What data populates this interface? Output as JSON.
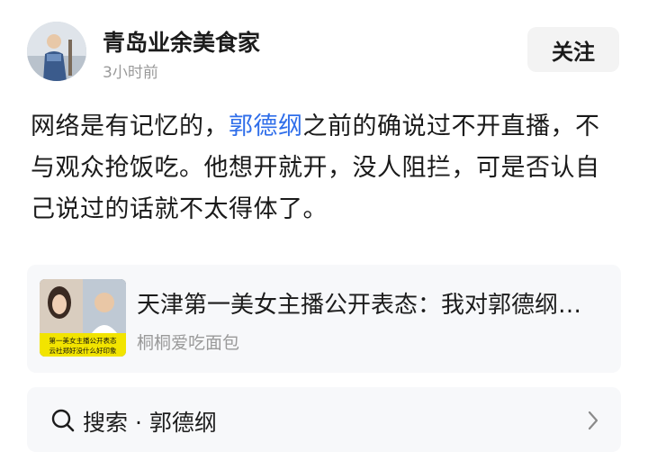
{
  "author": {
    "name": "青岛业余美食家",
    "time": "3小时前",
    "follow_label": "关注"
  },
  "post": {
    "text_before": "网络是有记忆的，",
    "topic": "郭德纲",
    "text_after": "之前的确说过不开直播，不与观众抢饭吃。他想开就开，没人阻拦，可是否认自己说过的话就不太得体了。"
  },
  "linked_card": {
    "title": "天津第一美女主播公开表态：我对郭德纲没什么好印象",
    "source": "桐桐爱吃面包",
    "thumb_caption_1": "第一美女主播公开表态",
    "thumb_caption_2": "云社郑好没什么好印象"
  },
  "search": {
    "label": "搜索 · 郭德纲"
  },
  "colors": {
    "link": "#2f6eea",
    "card_bg": "#f7f8fa",
    "button_bg": "#f3f3f3",
    "secondary_text": "#9a9a9a"
  }
}
